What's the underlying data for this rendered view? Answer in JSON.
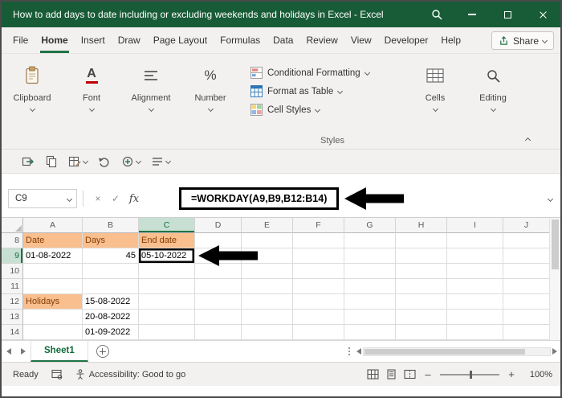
{
  "window": {
    "title": "How to add days to date including or excluding weekends and holidays in Excel - Excel"
  },
  "ribbon": {
    "tabs": [
      {
        "label": "File"
      },
      {
        "label": "Home",
        "active": true
      },
      {
        "label": "Insert"
      },
      {
        "label": "Draw"
      },
      {
        "label": "Page Layout"
      },
      {
        "label": "Formulas"
      },
      {
        "label": "Data"
      },
      {
        "label": "Review"
      },
      {
        "label": "View"
      },
      {
        "label": "Developer"
      },
      {
        "label": "Help"
      }
    ],
    "share_label": "Share",
    "groups": [
      {
        "label": "Clipboard",
        "icon": "clipboard-icon"
      },
      {
        "label": "Font",
        "icon": "font-icon"
      },
      {
        "label": "Alignment",
        "icon": "alignment-icon"
      },
      {
        "label": "Number",
        "icon": "number-icon"
      },
      {
        "label": "Styles",
        "items": [
          {
            "label": "Conditional Formatting",
            "icon": "conditional-formatting-icon"
          },
          {
            "label": "Format as Table",
            "icon": "format-as-table-icon"
          },
          {
            "label": "Cell Styles",
            "icon": "cell-styles-icon"
          }
        ]
      },
      {
        "label": "Cells",
        "icon": "cells-icon"
      },
      {
        "label": "Editing",
        "icon": "editing-icon"
      }
    ]
  },
  "icons": {
    "font_glyph": "A",
    "percent_glyph": "%",
    "cancel": "×",
    "enter": "✓",
    "fx": "fx"
  },
  "formula_bar": {
    "name_box": "C9",
    "formula": "=WORKDAY(A9,B9,B12:B14)"
  },
  "grid": {
    "columns": [
      "A",
      "B",
      "C",
      "D",
      "E",
      "F",
      "G",
      "H",
      "I",
      "J"
    ],
    "selected": {
      "column": "C",
      "row": "9"
    },
    "rows": [
      {
        "n": "8",
        "cells": {
          "A": {
            "t": "Date",
            "fill": true
          },
          "B": {
            "t": "Days",
            "fill": true
          },
          "C": {
            "t": "End date",
            "fill": true
          }
        }
      },
      {
        "n": "9",
        "cells": {
          "A": {
            "t": "01-08-2022"
          },
          "B": {
            "t": "45",
            "align": "right"
          },
          "C": {
            "t": "05-10-2022",
            "annotated": true
          }
        }
      },
      {
        "n": "10",
        "cells": {}
      },
      {
        "n": "11",
        "cells": {}
      },
      {
        "n": "12",
        "cells": {
          "A": {
            "t": "Holidays",
            "fill": true
          },
          "B": {
            "t": "15-08-2022"
          }
        }
      },
      {
        "n": "13",
        "cells": {
          "B": {
            "t": "20-08-2022"
          }
        }
      },
      {
        "n": "14",
        "cells": {
          "B": {
            "t": "01-09-2022"
          }
        }
      }
    ]
  },
  "sheet_bar": {
    "tabs": [
      {
        "label": "Sheet1",
        "active": true
      }
    ]
  },
  "status_bar": {
    "mode": "Ready",
    "accessibility": "Accessibility: Good to go",
    "zoom_out": "–",
    "zoom_in": "+",
    "zoom": "100%"
  }
}
